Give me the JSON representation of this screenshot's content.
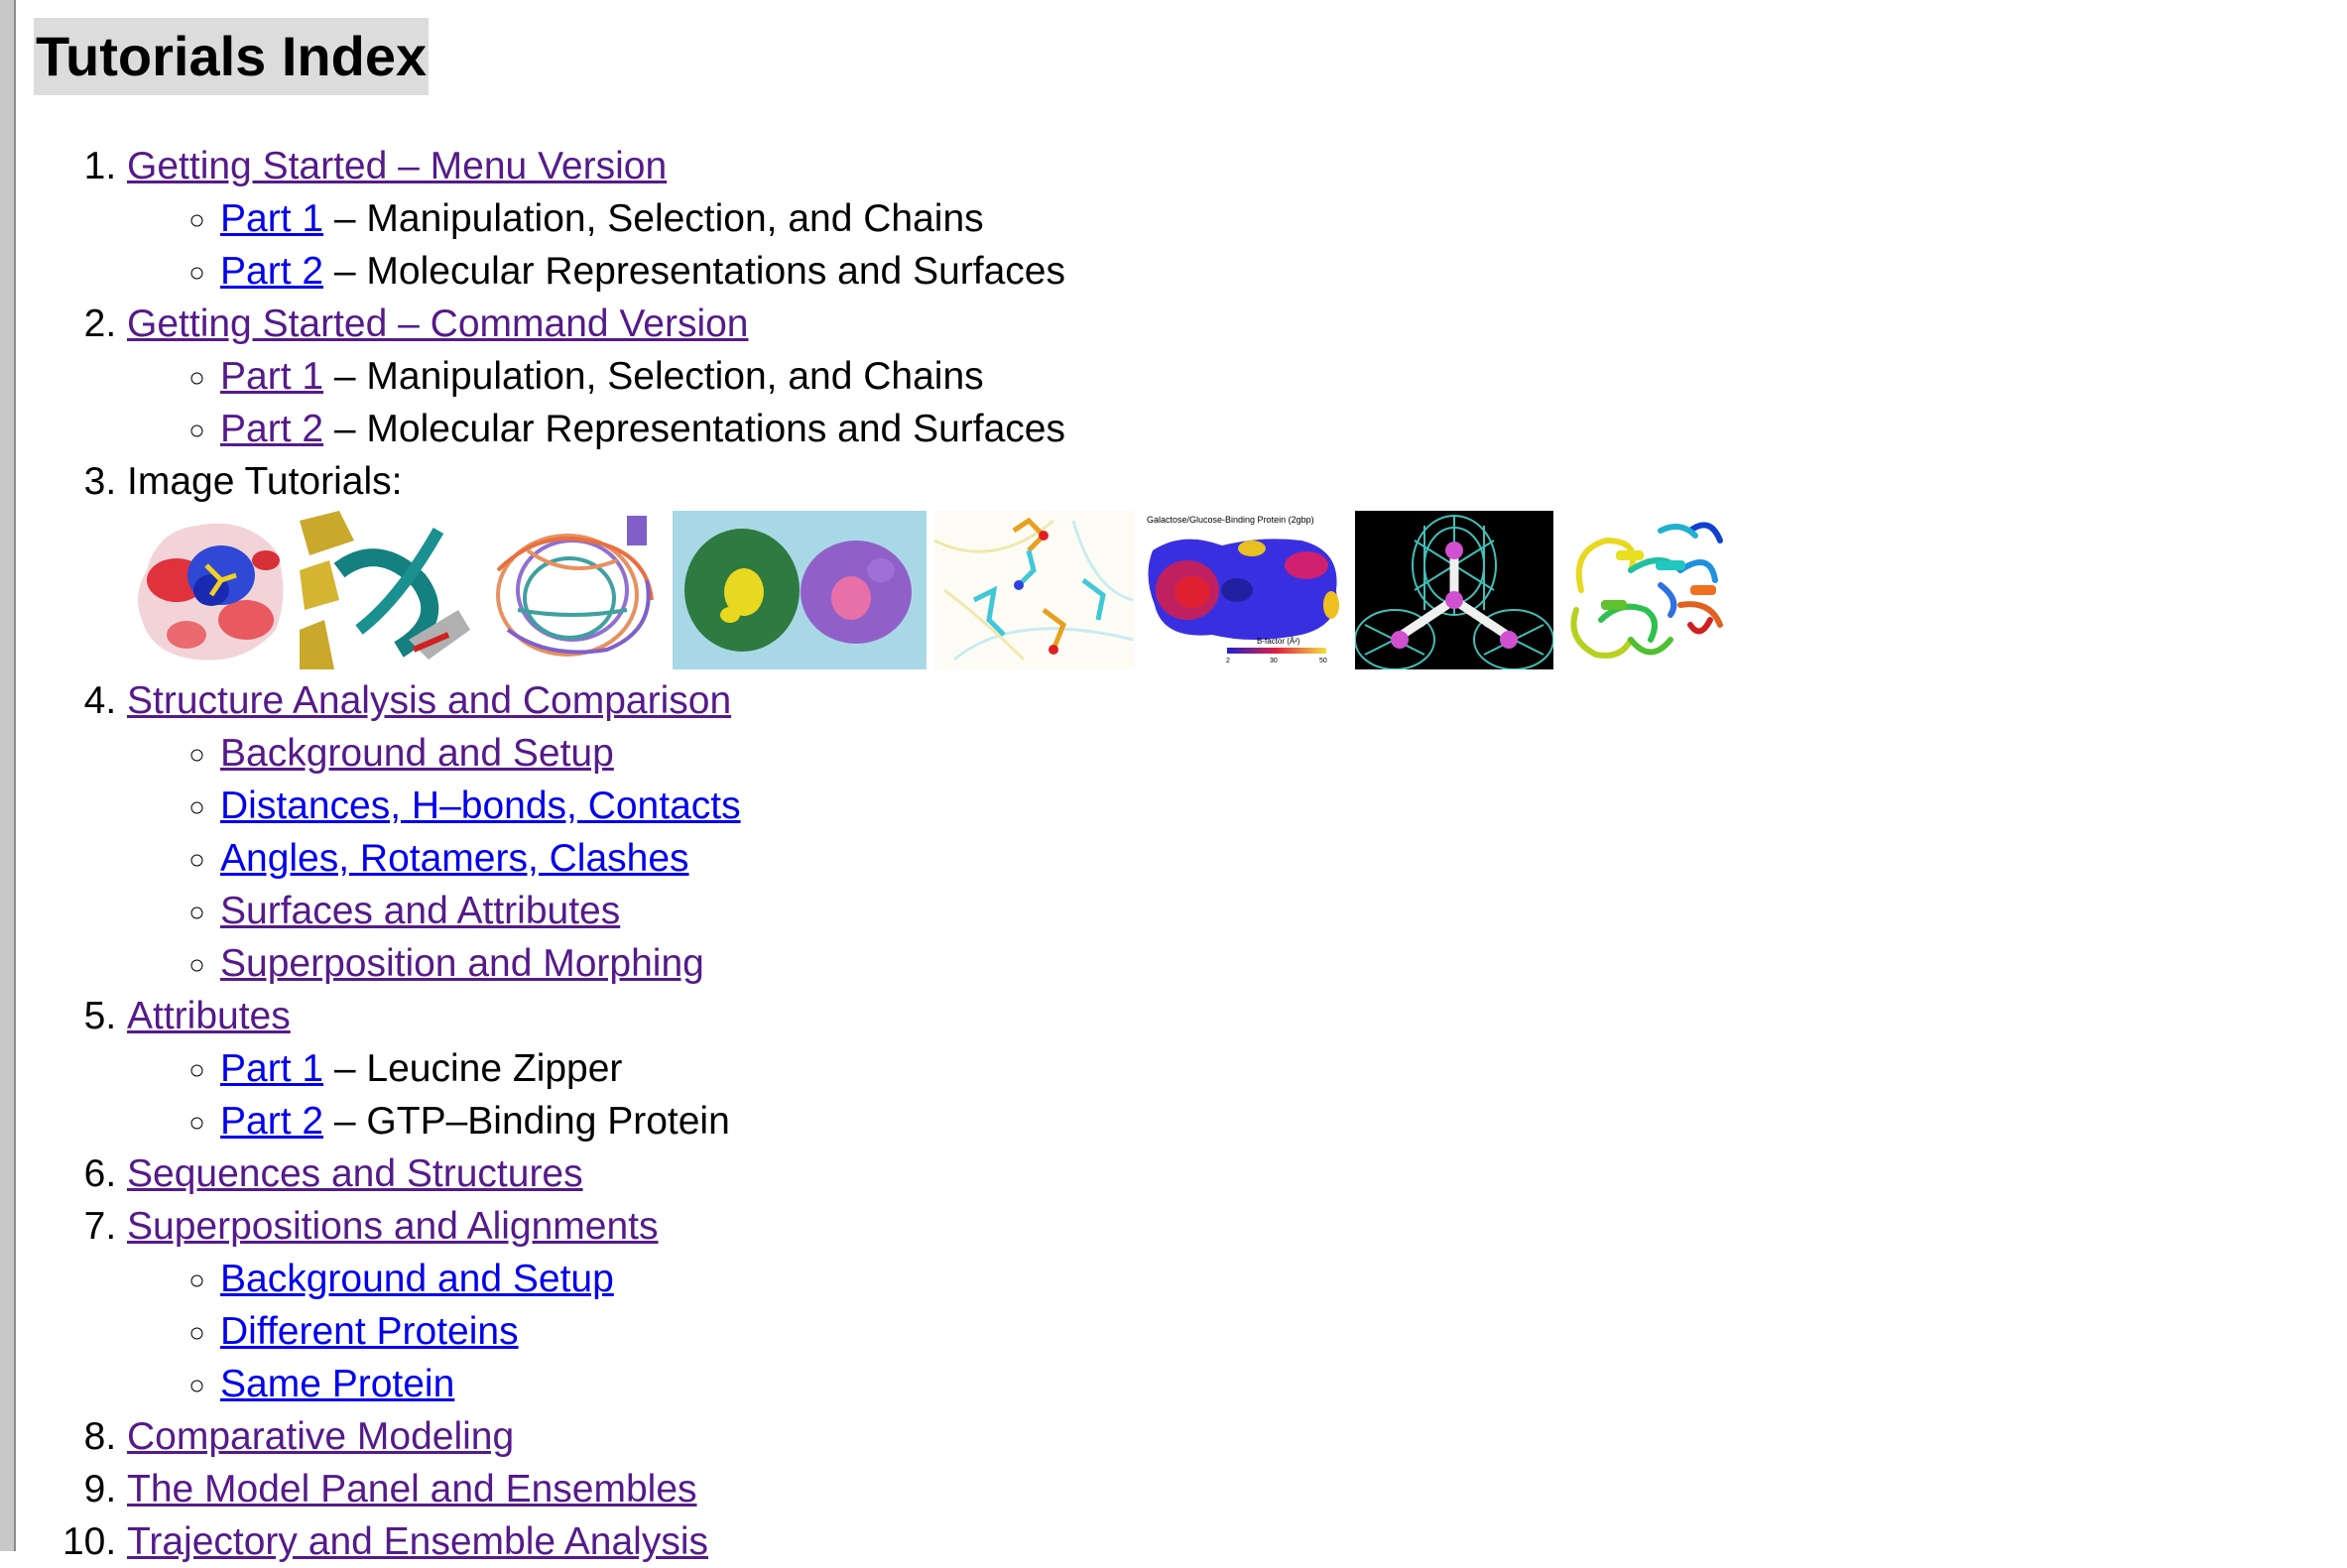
{
  "page": {
    "title": "Tutorials Index"
  },
  "items": [
    {
      "number": "1.",
      "link": "Getting Started – Menu Version",
      "subitems": [
        {
          "link": "Part 1",
          "text": " – Manipulation, Selection, and Chains"
        },
        {
          "link": "Part 2",
          "text": " – Molecular Representations and Surfaces"
        }
      ]
    },
    {
      "number": "2.",
      "link": "Getting Started – Command Version",
      "subitems": [
        {
          "link": "Part 1",
          "text": " – Manipulation, Selection, and Chains"
        },
        {
          "link": "Part 2",
          "text": " – Molecular Representations and Surfaces"
        }
      ]
    },
    {
      "number": "3.",
      "text": "Image Tutorials:",
      "images": [
        {
          "icon": "electrostatic-surface-image"
        },
        {
          "icon": "ribbon-ligand-image"
        },
        {
          "icon": "superposition-image"
        },
        {
          "icon": "two-surfaces-image"
        },
        {
          "icon": "sticks-hbonds-image"
        },
        {
          "icon": "bfactor-surface-image",
          "caption": "Galactose/Glucose-Binding Protein (2gbp)",
          "key_label": "B-factor (Å²)",
          "ticks": [
            "2",
            "30",
            "50"
          ]
        },
        {
          "icon": "density-mesh-image"
        },
        {
          "icon": "rainbow-cartoon-image"
        }
      ]
    },
    {
      "number": "4.",
      "link": "Structure Analysis and Comparison",
      "subitems": [
        {
          "link": "Background and Setup"
        },
        {
          "link": "Distances, H–bonds, Contacts"
        },
        {
          "link": "Angles, Rotamers, Clashes"
        },
        {
          "link": "Surfaces and Attributes"
        },
        {
          "link": "Superposition and Morphing"
        }
      ]
    },
    {
      "number": "5.",
      "link": "Attributes",
      "subitems": [
        {
          "link": "Part 1",
          "text": " – Leucine Zipper"
        },
        {
          "link": "Part 2",
          "text": " – GTP–Binding Protein"
        }
      ]
    },
    {
      "number": "6.",
      "link": "Sequences and Structures"
    },
    {
      "number": "7.",
      "link": "Superpositions and Alignments",
      "subitems": [
        {
          "link": "Background and Setup"
        },
        {
          "link": "Different Proteins"
        },
        {
          "link": "Same Protein"
        }
      ]
    },
    {
      "number": "8.",
      "link": "Comparative Modeling"
    },
    {
      "number": "9.",
      "link": "The Model Panel and Ensembles"
    },
    {
      "number": "10.",
      "link": "Trajectory and Ensemble Analysis"
    }
  ]
}
